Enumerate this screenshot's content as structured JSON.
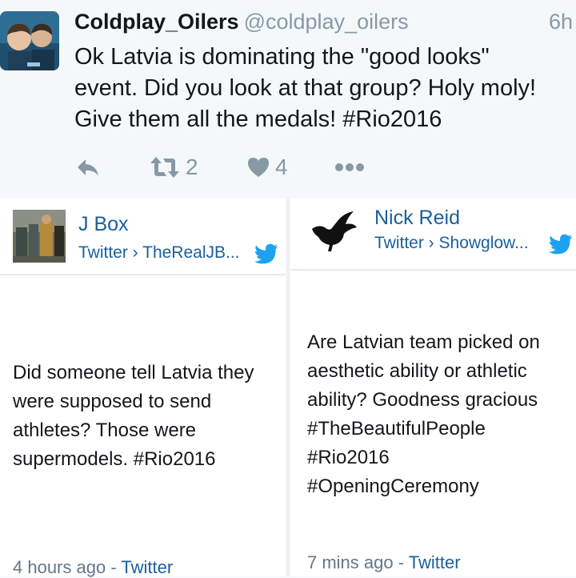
{
  "tweet": {
    "author_name": "Coldplay_Oilers",
    "author_handle": "@coldplay_oilers",
    "time": "6h",
    "text_lines": [
      "Ok Latvia is dominating the \"good looks\"",
      "event. Did you look at that group? Holy moly!",
      "Give them all the medals! #Rio2016"
    ],
    "retweet_count": "2",
    "like_count": "4",
    "icons": [
      "reply-icon",
      "retweet-icon",
      "heart-icon",
      "more-icon"
    ]
  },
  "cards": [
    {
      "author": "J Box",
      "source": "Twitter › TheRealJB...",
      "text_lines": [
        "Did someone tell Latvia they",
        "were supposed to send",
        "athletes? Those were",
        "supermodels. #Rio2016"
      ],
      "time_ago": "4 hours ago",
      "separator": " - ",
      "platform": "Twitter"
    },
    {
      "author": "Nick Reid",
      "source": "Twitter › Showglow...",
      "text_lines": [
        "Are Latvian team picked on",
        "aesthetic ability or athletic",
        "ability? Goodness gracious",
        "#TheBeautifulPeople",
        "#Rio2016",
        "#OpeningCeremony"
      ],
      "time_ago": "7 mins ago",
      "separator": " - ",
      "platform": "Twitter"
    }
  ],
  "colors": {
    "link_blue": "#1b5f9c",
    "twitter_blue": "#1da1f2",
    "muted": "#8899a6"
  }
}
